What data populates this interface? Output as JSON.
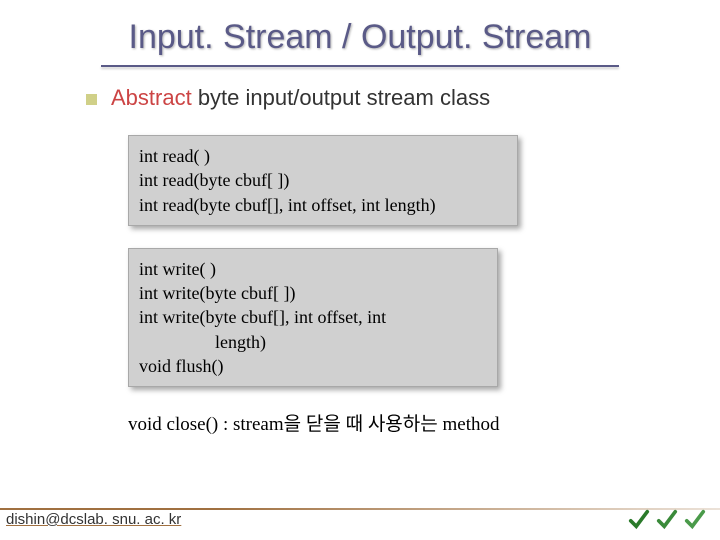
{
  "title": "Input. Stream / Output. Stream",
  "bullet": {
    "abstract": "Abstract",
    "rest": " byte input/output stream class"
  },
  "code1": {
    "l1": "int read( )",
    "l2": "int read(byte cbuf[ ])",
    "l3": "int read(byte cbuf[], int offset, int length)"
  },
  "code2": {
    "l1": "int write( )",
    "l2": "int write(byte cbuf[ ])",
    "l3": "int write(byte cbuf[], int offset, int",
    "l3b": "length)",
    "l4": "void flush()"
  },
  "close_line": "void close() : stream을 닫을 때 사용하는 method",
  "footer": "dishin@dcslab. snu. ac. kr"
}
